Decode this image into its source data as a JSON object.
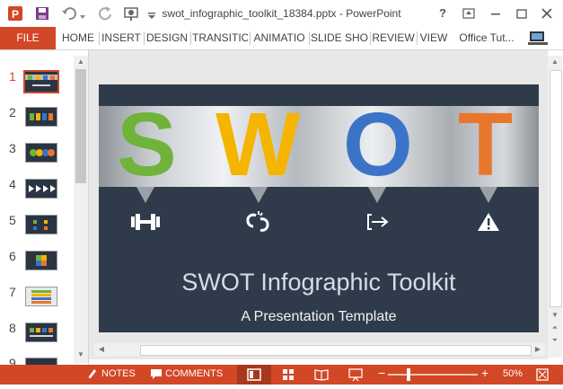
{
  "window": {
    "title": "swot_infographic_toolkit_18384.pptx - PowerPoint",
    "controls": {
      "help": "?"
    }
  },
  "ribbon": {
    "file_label": "FILE",
    "tabs": [
      "HOME",
      "INSERT",
      "DESIGN",
      "TRANSITIO",
      "ANIMATIO",
      "SLIDE SHO",
      "REVIEW",
      "VIEW"
    ],
    "account": "Office Tut..."
  },
  "thumbnails": {
    "numbers": [
      "1",
      "2",
      "3",
      "4",
      "5",
      "6",
      "7",
      "8",
      "9"
    ],
    "selected": "1"
  },
  "slide": {
    "letters": [
      "S",
      "W",
      "O",
      "T"
    ],
    "letter_colors": [
      "#6fb33a",
      "#f5b400",
      "#3b73c9",
      "#e8772e"
    ],
    "title": "SWOT Infographic Toolkit",
    "subtitle": "A Presentation Template",
    "icons": [
      "dumbbell-icon",
      "broken-link-icon",
      "arrow-exit-icon",
      "warning-icon"
    ]
  },
  "statusbar": {
    "notes_label": "NOTES",
    "comments_label": "COMMENTS",
    "zoom_minus": "−",
    "zoom_plus": "+",
    "zoom_level": "50%",
    "zoom_fraction": 0.5
  },
  "colors": {
    "accent": "#d24726",
    "slide_bg": "#2f3b4b"
  }
}
